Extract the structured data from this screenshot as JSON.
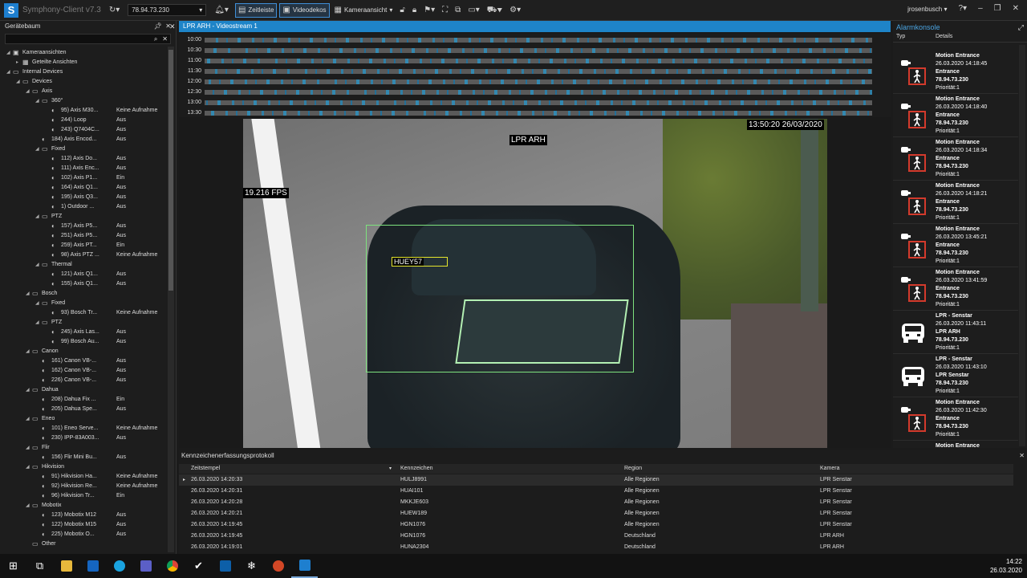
{
  "app": {
    "title": "Symphony-Client v7.3",
    "logo_letter": "S",
    "server_ip": "78.94.73.230",
    "user": "jrosenbusch"
  },
  "toolbar": {
    "timeline_label": "Zeitleiste",
    "videodecks_label": "Videodekos",
    "cameraview_label": "Kameraansicht"
  },
  "left": {
    "title": "Gerätebaum"
  },
  "tree": [
    {
      "depth": 0,
      "arrow": "◢",
      "icon": "▣",
      "label": "Kameraansichten",
      "status": ""
    },
    {
      "depth": 1,
      "arrow": "▸",
      "icon": "▦",
      "label": "Geteilte Ansichten",
      "status": ""
    },
    {
      "depth": 0,
      "arrow": "◢",
      "icon": "▭",
      "label": "Internal Devices",
      "status": ""
    },
    {
      "depth": 1,
      "arrow": "◢",
      "icon": "▭",
      "label": "Devices",
      "status": ""
    },
    {
      "depth": 2,
      "arrow": "◢",
      "icon": "▭",
      "label": "Axis",
      "status": ""
    },
    {
      "depth": 3,
      "arrow": "◢",
      "icon": "▭",
      "label": "360°",
      "status": ""
    },
    {
      "depth": 4,
      "arrow": "",
      "icon": "◐",
      "label": "95) Axis M30...",
      "status": "Keine Aufnahme"
    },
    {
      "depth": 4,
      "arrow": "",
      "icon": "◐",
      "label": "244) Loop",
      "status": "Aus"
    },
    {
      "depth": 4,
      "arrow": "",
      "icon": "◐",
      "label": "243) Q7404C...",
      "status": "Aus"
    },
    {
      "depth": 3,
      "arrow": "",
      "icon": "◐",
      "label": "184) Axis Encod...",
      "status": "Aus"
    },
    {
      "depth": 3,
      "arrow": "◢",
      "icon": "▭",
      "label": "Fixed",
      "status": ""
    },
    {
      "depth": 4,
      "arrow": "",
      "icon": "◐",
      "label": "112) Axis Do...",
      "status": "Aus"
    },
    {
      "depth": 4,
      "arrow": "",
      "icon": "◐",
      "label": "111) Axis Enc...",
      "status": "Aus"
    },
    {
      "depth": 4,
      "arrow": "",
      "icon": "◐",
      "label": "102) Axis P1...",
      "status": "Ein"
    },
    {
      "depth": 4,
      "arrow": "",
      "icon": "◐",
      "label": "164) Axis Q1...",
      "status": "Aus"
    },
    {
      "depth": 4,
      "arrow": "",
      "icon": "◐",
      "label": "195) Axis Q3...",
      "status": "Aus"
    },
    {
      "depth": 4,
      "arrow": "",
      "icon": "◐",
      "label": "1) Outdoor ...",
      "status": "Aus"
    },
    {
      "depth": 3,
      "arrow": "◢",
      "icon": "▭",
      "label": "PTZ",
      "status": ""
    },
    {
      "depth": 4,
      "arrow": "",
      "icon": "◐",
      "label": "157) Axis P5...",
      "status": "Aus"
    },
    {
      "depth": 4,
      "arrow": "",
      "icon": "◐",
      "label": "251) Axis P5...",
      "status": "Aus"
    },
    {
      "depth": 4,
      "arrow": "",
      "icon": "◐",
      "label": "259) Axis PT...",
      "status": "Ein"
    },
    {
      "depth": 4,
      "arrow": "",
      "icon": "◐",
      "label": "98) Axis PTZ ...",
      "status": "Keine Aufnahme"
    },
    {
      "depth": 3,
      "arrow": "◢",
      "icon": "▭",
      "label": "Thermal",
      "status": ""
    },
    {
      "depth": 4,
      "arrow": "",
      "icon": "◐",
      "label": "121) Axis Q1...",
      "status": "Aus"
    },
    {
      "depth": 4,
      "arrow": "",
      "icon": "◐",
      "label": "155) Axis Q1...",
      "status": "Aus"
    },
    {
      "depth": 2,
      "arrow": "◢",
      "icon": "▭",
      "label": "Bosch",
      "status": ""
    },
    {
      "depth": 3,
      "arrow": "◢",
      "icon": "▭",
      "label": "Fixed",
      "status": ""
    },
    {
      "depth": 4,
      "arrow": "",
      "icon": "◐",
      "label": "93) Bosch Tr...",
      "status": "Keine Aufnahme"
    },
    {
      "depth": 3,
      "arrow": "◢",
      "icon": "▭",
      "label": "PTZ",
      "status": ""
    },
    {
      "depth": 4,
      "arrow": "",
      "icon": "◐",
      "label": "245) Axis Las...",
      "status": "Aus"
    },
    {
      "depth": 4,
      "arrow": "",
      "icon": "◐",
      "label": "99) Bosch Au...",
      "status": "Aus"
    },
    {
      "depth": 2,
      "arrow": "◢",
      "icon": "▭",
      "label": "Canon",
      "status": ""
    },
    {
      "depth": 3,
      "arrow": "",
      "icon": "◐",
      "label": "161) Canon VB-...",
      "status": "Aus"
    },
    {
      "depth": 3,
      "arrow": "",
      "icon": "◐",
      "label": "162) Canon VB-...",
      "status": "Aus"
    },
    {
      "depth": 3,
      "arrow": "",
      "icon": "◐",
      "label": "226) Canon VB-...",
      "status": "Aus"
    },
    {
      "depth": 2,
      "arrow": "◢",
      "icon": "▭",
      "label": "Dahua",
      "status": ""
    },
    {
      "depth": 3,
      "arrow": "",
      "icon": "◐",
      "label": "208) Dahua Fix ...",
      "status": "Ein"
    },
    {
      "depth": 3,
      "arrow": "",
      "icon": "◐",
      "label": "205) Dahua Spe...",
      "status": "Aus"
    },
    {
      "depth": 2,
      "arrow": "◢",
      "icon": "▭",
      "label": "Eneo",
      "status": ""
    },
    {
      "depth": 3,
      "arrow": "",
      "icon": "◐",
      "label": "101) Eneo Serve...",
      "status": "Keine Aufnahme"
    },
    {
      "depth": 3,
      "arrow": "",
      "icon": "◐",
      "label": "230) IPP-83A003...",
      "status": "Aus"
    },
    {
      "depth": 2,
      "arrow": "◢",
      "icon": "▭",
      "label": "Flir",
      "status": ""
    },
    {
      "depth": 3,
      "arrow": "",
      "icon": "◐",
      "label": "156) Flir Mini Bu...",
      "status": "Aus"
    },
    {
      "depth": 2,
      "arrow": "◢",
      "icon": "▭",
      "label": "Hikvision",
      "status": ""
    },
    {
      "depth": 3,
      "arrow": "",
      "icon": "◐",
      "label": "91) Hikvision Ha...",
      "status": "Keine Aufnahme"
    },
    {
      "depth": 3,
      "arrow": "",
      "icon": "◐",
      "label": "92) Hikvision Re...",
      "status": "Keine Aufnahme"
    },
    {
      "depth": 3,
      "arrow": "",
      "icon": "◐",
      "label": "96) Hikvision Tr...",
      "status": "Ein"
    },
    {
      "depth": 2,
      "arrow": "◢",
      "icon": "▭",
      "label": "Mobotix",
      "status": ""
    },
    {
      "depth": 3,
      "arrow": "",
      "icon": "◐",
      "label": "123) Mobotix M12",
      "status": "Aus"
    },
    {
      "depth": 3,
      "arrow": "",
      "icon": "◐",
      "label": "122) Mobotix M15",
      "status": "Aus"
    },
    {
      "depth": 3,
      "arrow": "",
      "icon": "◐",
      "label": "225) Mobotix O...",
      "status": "Aus"
    },
    {
      "depth": 2,
      "arrow": "",
      "icon": "▭",
      "label": "Other",
      "status": ""
    }
  ],
  "video": {
    "title": "LPR ARH - Videostream 1",
    "camera_label": "LPR ARH",
    "timestamp": "13:50:20 26/03/2020",
    "fps": "19.216 FPS",
    "plate": "HUEY57"
  },
  "timeline": {
    "times": [
      "10:00",
      "10:30",
      "11:00",
      "11:30",
      "12:00",
      "12:30",
      "13:00",
      "13:30"
    ]
  },
  "alarms": {
    "title": "Alarmkonsole",
    "col_type": "Typ",
    "col_details": "Details",
    "items": [
      {
        "icon": "motion-alarm-icon",
        "name": "Motion Entrance",
        "time": "26.03.2020 14:18:45",
        "camera": "Entrance",
        "ip": "78.94.73.230",
        "prio": "Priorität:1"
      },
      {
        "icon": "motion-alarm-icon",
        "name": "Motion Entrance",
        "time": "26.03.2020 14:18:40",
        "camera": "Entrance",
        "ip": "78.94.73.230",
        "prio": "Priorität:1"
      },
      {
        "icon": "motion-alarm-icon",
        "name": "Motion Entrance",
        "time": "26.03.2020 14:18:34",
        "camera": "Entrance",
        "ip": "78.94.73.230",
        "prio": "Priorität:1"
      },
      {
        "icon": "motion-alarm-icon",
        "name": "Motion Entrance",
        "time": "26.03.2020 14:18:21",
        "camera": "Entrance",
        "ip": "78.94.73.230",
        "prio": "Priorität:1"
      },
      {
        "icon": "motion-alarm-icon",
        "name": "Motion Entrance",
        "time": "26.03.2020 13:45:21",
        "camera": "Entrance",
        "ip": "78.94.73.230",
        "prio": "Priorität:1"
      },
      {
        "icon": "motion-alarm-icon",
        "name": "Motion Entrance",
        "time": "26.03.2020 13:41:59",
        "camera": "Entrance",
        "ip": "78.94.73.230",
        "prio": "Priorität:1"
      },
      {
        "icon": "car-alarm-icon",
        "name": "LPR - Senstar",
        "time": "26.03.2020 11:43:11",
        "camera": "LPR ARH",
        "ip": "78.94.73.230",
        "prio": "Priorität:1"
      },
      {
        "icon": "car-alarm-icon",
        "name": "LPR - Senstar",
        "time": "26.03.2020 11:43:10",
        "camera": "LPR Senstar",
        "ip": "78.94.73.230",
        "prio": "Priorität:1"
      },
      {
        "icon": "motion-alarm-icon",
        "name": "Motion Entrance",
        "time": "26.03.2020 11:42:30",
        "camera": "Entrance",
        "ip": "78.94.73.230",
        "prio": "Priorität:1"
      },
      {
        "icon": "motion-alarm-icon",
        "name": "Motion Entrance",
        "time": "",
        "camera": "",
        "ip": "",
        "prio": ""
      }
    ]
  },
  "log": {
    "title": "Kennzeichenerfassungsprotokoll",
    "columns": [
      "Zeitstempel",
      "Kennzeichen",
      "Region",
      "Kamera"
    ],
    "rows": [
      [
        "26.03.2020 14:20:33",
        "HULJ8991",
        "Alle Regionen",
        "LPR Senstar"
      ],
      [
        "26.03.2020 14:20:31",
        "HUAI101",
        "Alle Regionen",
        "LPR Senstar"
      ],
      [
        "26.03.2020 14:20:28",
        "MKKJE603",
        "Alle Regionen",
        "LPR Senstar"
      ],
      [
        "26.03.2020 14:20:21",
        "HUEW189",
        "Alle Regionen",
        "LPR Senstar"
      ],
      [
        "26.03.2020 14:19:45",
        "HGN1076",
        "Alle Regionen",
        "LPR Senstar"
      ],
      [
        "26.03.2020 14:19:45",
        "HGN1076",
        "Deutschland",
        "LPR ARH"
      ],
      [
        "26.03.2020 14:19:01",
        "HUNA2304",
        "Deutschland",
        "LPR ARH"
      ]
    ]
  },
  "taskbar": {
    "time": "14:22",
    "date": "26.03.2020"
  },
  "colors": {
    "accent": "#1e84c8",
    "bbox": "#7ee27e",
    "plate_box": "#e5e52c",
    "alarm_red": "#d33a2c"
  }
}
